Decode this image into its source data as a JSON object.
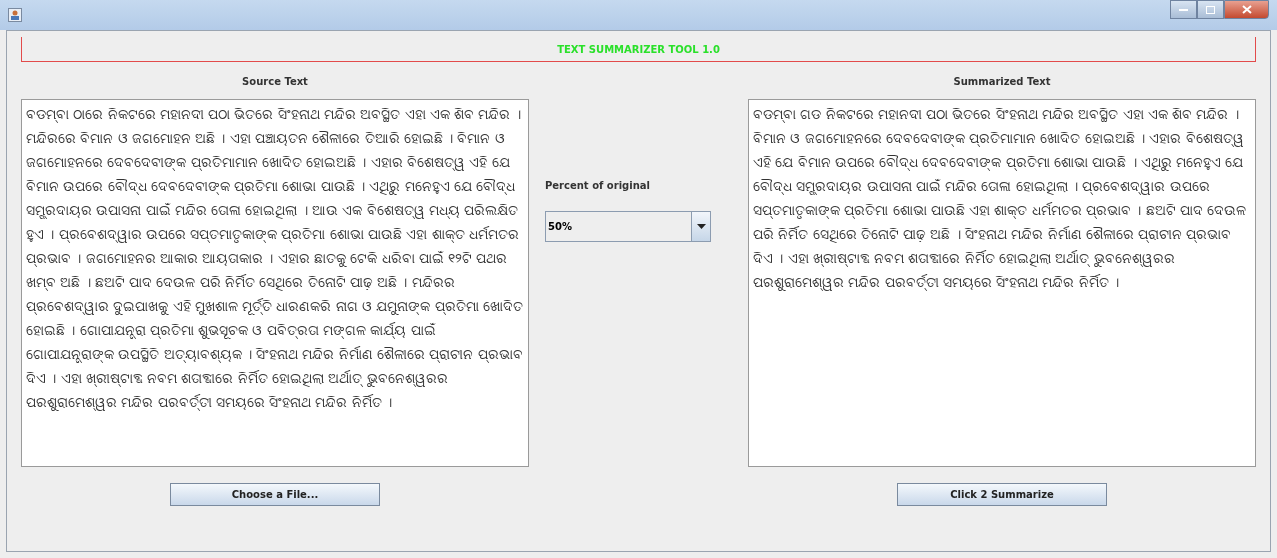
{
  "header": {
    "title": "TEXT SUMMARIZER TOOL 1.0"
  },
  "source": {
    "label": "Source Text",
    "text": "ବଡମ୍ବା ଠାରେ ନିକଟରେ ମହାନଦୀ ପଠା ଭିତରେ ସିଂହନାଥ ମନ୍ଦିର ଅବସ୍ଥିତ ଏହା ଏକ ଶିବ ମନ୍ଦିର । ମନ୍ଦିରରେ ବିମାନ ଓ ଜଗମୋହନ ଅଛି ।  ଏହା ପଞ୍ଚାୟତନ ଶୈଳୀରେ ତିଆରି ହୋଇଛି । ବିମାନ ଓ ଜଗମୋହନରେ ଦେବଦେବୀଙ୍କ ପ୍ରତିମାମାନ ଖୋଦିତ ହୋଇଅଛି । ଏହାର ବିଶେଷତ୍ୱ ଏହି ଯେ ବିମାନ ଉପରେ ବୌଦ୍ଧ ଦେବଦେବୀଙ୍କ ପ୍ରତିମା ଶୋଭା ପାଉଛି । ଏଥିରୁ ମନେହୁଏ ଯେ ବୌଦ୍ଧ ସମ୍ପ୍ରଦାୟର ଉପାସନା ପାଇଁ ମନ୍ଦିର ତୋଳା ହୋଇଥିଲା । ଆଉ ଏକ ବିଶେଷତ୍ୱ ମଧ୍ୟ ପରିଲକ୍ଷିତ ହୁଏ । ପ୍ରବେଶଦ୍ୱାର ଉପରେ ସପ୍ତମାତୃକାଙ୍କ ପ୍ରତିମା ଶୋଭା ପାଉଛି ଏହା ଶାକ୍ତ ଧର୍ମମତର  ପ୍ରଭାବ । ଜଗମୋହନର ଆକାର ଆୟତାକାର । ଏହାର ଛାତକୁ ଟେକି ଧରିବା ପାଇଁ ୧୨ଟି ପଥର ଖମ୍ବ ଅଛି । ଛଅଟି ପାଦ ଦେଉଳ ପରି ନିର୍ମିତ ସେଥିରେ ତିନୋଟି ପୀଢ଼ ଅଛି । ମନ୍ଦିରର ପ୍ରବେଶଦ୍ୱାର ଦୁଇପାଖକୁ ଏହି ମୁଖଶାଳ ମୂର୍ତ୍ତି ଧାରଣକରି ନାଗ ଓ ଯମୁନାଙ୍କ ପ୍ରତିମା ଖୋଦିତ ହୋଇଛି । ଗୋପୀଯନ୍ତ୍ରା ପ୍ରତିମା ଶୁଭସୂଚକ ଓ ପବିତ୍ରତା ମଙ୍ଗଳ କାର୍ଯ୍ୟ ପାଇଁ ଗୋପୀଯନ୍ତ୍ରାଙ୍କ ଉପସ୍ଥିତି ଅତ୍ୟାବଶ୍ୟକ । ସିଂହନାଥ ମନ୍ଦିର ନିର୍ମାଣ ଶୈଳୀରେ ପ୍ରାଚୀନ ପ୍ରଭାବ ଦିଏ । ଏହା ଖ୍ରୀଷ୍ଟାବ୍ଦ ନବମ ଶତାବ୍ଦୀରେ ନିର୍ମିତ ହୋଇଥିଲା ଅର୍ଥାତ୍ ଭୁବନେଶ୍ୱରର ପରଶୁରାମେଶ୍ୱର ମନ୍ଦିର ପରବର୍ତ୍ତୀ ସମୟରେ ସିଂହନାଥ ମନ୍ଦିର ନିର୍ମିତ ।"
  },
  "summary": {
    "label": "Summarized Text",
    "text": "ବଡମ୍ବା ଗଡ ନିକଟରେ ମହାନଦୀ ପଠା ଭିତରେ ସିଂହନାଥ ମନ୍ଦିର ଅବସ୍ଥିତ ଏହା ଏକ ଶିବ ମନ୍ଦିର ।  ବିମାନ ଓ ଜଗମୋହନରେ ଦେବଦେବୀଙ୍କ ପ୍ରତିମାମାନ ଖୋଦିତ ହୋଇଅଛି । ଏହାର ବିଶେଷତ୍ୱ ଏହି ଯେ ବିମାନ ଉପରେ ବୌଦ୍ଧ ଦେବଦେବୀଙ୍କ ପ୍ରତିମା ଶୋଭା ପାଉଛି । ଏଥିରୁ ମନେହୁଏ ଯେ ବୌଦ୍ଧ ସମ୍ପ୍ରଦାୟର ଉପାସନା ପାଇଁ ମନ୍ଦିର ତୋଳା ହୋଇଥିଲା । ପ୍ରବେଶଦ୍ୱାର ଉପରେ ସପ୍ତମାତୃକାଙ୍କ ପ୍ରତିମା ଶୋଭା ପାଉଛି ଏହା ଶାକ୍ତ ଧର୍ମମତର  ପ୍ରଭାବ ।  ଛଅଟି ପାଦ ଦେଉଳ ପରି ନିର୍ମିତ ସେଥିରେ ତିନୋଟି ପୀଢ଼ ଅଛି ।  ସିଂହନାଥ ମନ୍ଦିର  ନିର୍ମାଣ ଶୈଳୀରେ ପ୍ରାଚୀନ ପ୍ରଭାବ ଦିଏ ।  ଏହା ଖ୍ରୀଷ୍ଟାବ୍ଦ ନବମ ଶତାବ୍ଦୀରେ ନିର୍ମିତ ହୋଇଥିଲା ଅର୍ଥାତ୍ ଭୁବନେଶ୍ୱରର ପରଶୁରାମେଶ୍ୱର ମନ୍ଦିର ପରବର୍ତ୍ତୀ ସମୟରେ ସିଂହନାଥ ମନ୍ଦିର ନିର୍ମିତ ।"
  },
  "percent": {
    "label": "Percent of original",
    "value": "50%"
  },
  "buttons": [
    "Choose a File...",
    "Click 2 Summarize"
  ]
}
